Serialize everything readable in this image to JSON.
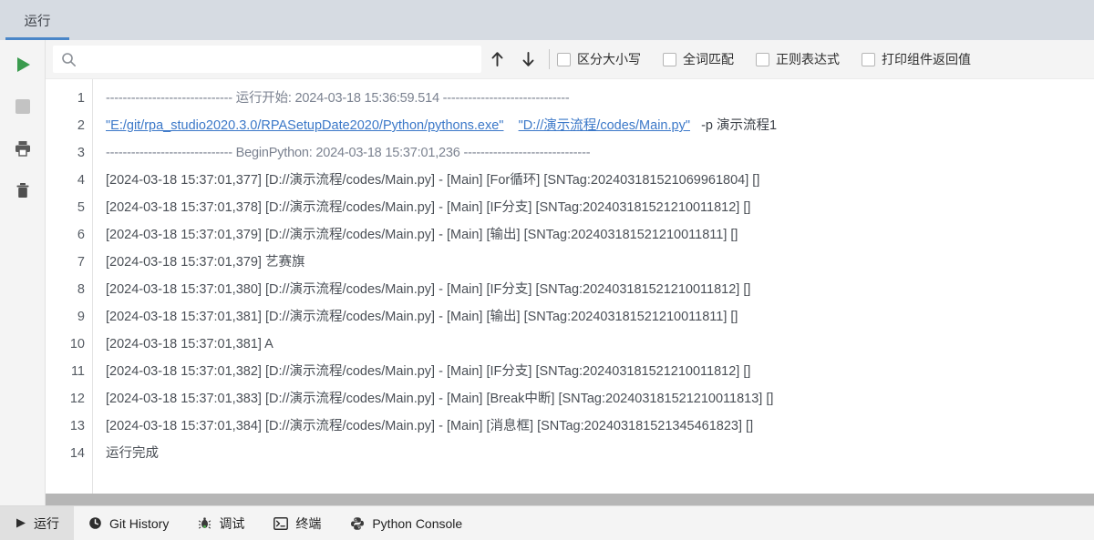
{
  "top_tabs": [
    {
      "label": "运行",
      "active": true
    }
  ],
  "rail": {
    "buttons": [
      {
        "name": "run-icon",
        "title": "运行"
      },
      {
        "name": "stop-icon",
        "title": "停止"
      },
      {
        "name": "print-icon",
        "title": "打印"
      },
      {
        "name": "trash-icon",
        "title": "清空"
      }
    ]
  },
  "toolbar": {
    "search": {
      "value": "",
      "placeholder": ""
    },
    "prev_label": "↑",
    "next_label": "↓",
    "checkboxes": [
      {
        "label": "区分大小写",
        "checked": false
      },
      {
        "label": "全词匹配",
        "checked": false
      },
      {
        "label": "正则表达式",
        "checked": false
      },
      {
        "label": "打印组件返回值",
        "checked": false
      }
    ]
  },
  "console": {
    "line_numbers": [
      "1",
      "2",
      "3",
      "4",
      "5",
      "6",
      "7",
      "8",
      "9",
      "10",
      "11",
      "12",
      "13",
      "14"
    ],
    "lines": [
      {
        "type": "separator",
        "text": "------------------------------ 运行开始: 2024-03-18 15:36:59.514 ------------------------------"
      },
      {
        "type": "command",
        "link1": "\"E:/git/rpa_studio2020.3.0/RPASetupDate2020/Python/pythons.exe\"",
        "link2": "\"D://演示流程/codes/Main.py\"",
        "tail": "-p  演示流程1"
      },
      {
        "type": "separator",
        "text": "------------------------------ BeginPython: 2024-03-18 15:37:01,236 ------------------------------"
      },
      {
        "type": "log",
        "text": "[2024-03-18 15:37:01,377] [D://演示流程/codes/Main.py] - [Main] [For循环] [SNTag:202403181521069961804] []"
      },
      {
        "type": "log",
        "text": "[2024-03-18 15:37:01,378] [D://演示流程/codes/Main.py] - [Main] [IF分支] [SNTag:202403181521210011812] []"
      },
      {
        "type": "log",
        "text": "[2024-03-18 15:37:01,379] [D://演示流程/codes/Main.py] - [Main] [输出] [SNTag:202403181521210011811] []"
      },
      {
        "type": "log",
        "text": "[2024-03-18 15:37:01,379] 艺赛旗"
      },
      {
        "type": "log",
        "text": "[2024-03-18 15:37:01,380] [D://演示流程/codes/Main.py] - [Main] [IF分支] [SNTag:202403181521210011812] []"
      },
      {
        "type": "log",
        "text": "[2024-03-18 15:37:01,381] [D://演示流程/codes/Main.py] - [Main] [输出] [SNTag:202403181521210011811] []"
      },
      {
        "type": "log",
        "text": "[2024-03-18 15:37:01,381] A"
      },
      {
        "type": "log",
        "text": "[2024-03-18 15:37:01,382] [D://演示流程/codes/Main.py] - [Main] [IF分支] [SNTag:202403181521210011812] []"
      },
      {
        "type": "log",
        "text": "[2024-03-18 15:37:01,383] [D://演示流程/codes/Main.py] - [Main] [Break中断] [SNTag:202403181521210011813] []"
      },
      {
        "type": "log",
        "text": "[2024-03-18 15:37:01,384] [D://演示流程/codes/Main.py] - [Main] [消息框] [SNTag:202403181521345461823] []"
      },
      {
        "type": "log",
        "text": "运行完成"
      }
    ]
  },
  "bottom_tabs": [
    {
      "label": "运行",
      "icon": "run-triangle-icon",
      "active": true
    },
    {
      "label": "Git History",
      "icon": "clock-icon",
      "active": false
    },
    {
      "label": "调试",
      "icon": "bug-icon",
      "active": false
    },
    {
      "label": "终端",
      "icon": "terminal-icon",
      "active": false
    },
    {
      "label": "Python Console",
      "icon": "python-icon",
      "active": false
    }
  ],
  "colors": {
    "accent": "#4a86c8",
    "link": "#3b78c8",
    "run_green": "#3a9b4e",
    "titlebar_bg": "#d6dbe2",
    "toolbar_bg": "#f4f4f4",
    "scrollbar": "#b6b6b6"
  }
}
